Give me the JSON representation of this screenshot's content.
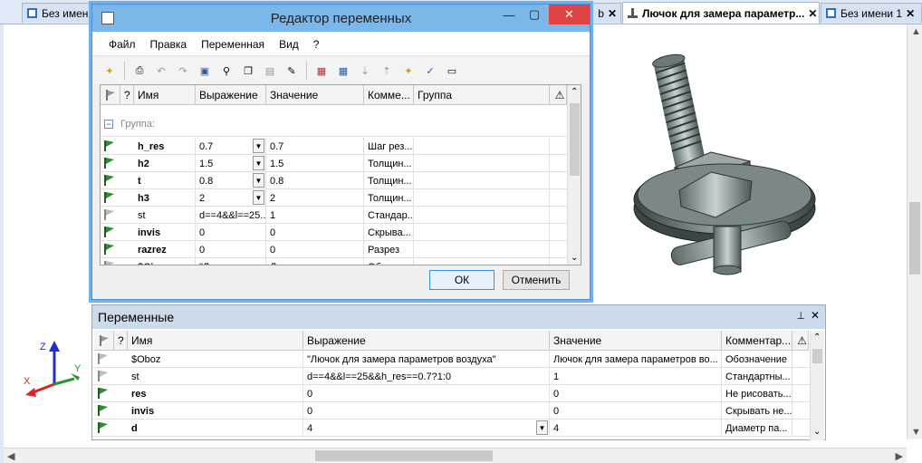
{
  "doc_tabs": [
    {
      "label": "Без имени",
      "close": ""
    },
    {
      "label": "b",
      "close": "✕"
    },
    {
      "label": "Лючок для замера параметр...",
      "close": "✕"
    },
    {
      "label": "Без имени 1",
      "close": "✕"
    }
  ],
  "dialog": {
    "title": "Редактор переменных",
    "menus": [
      "Файл",
      "Правка",
      "Переменная",
      "Вид",
      "?"
    ],
    "columns": [
      "",
      "?",
      "Имя",
      "Выражение",
      "Значение",
      "Комме...",
      "Группа"
    ],
    "group_label": "Группа:",
    "rows": [
      {
        "flag": true,
        "name": "h_res",
        "bold": true,
        "expr": "0.7",
        "dropdown": true,
        "value": "0.7",
        "comment": "Шаг рез..."
      },
      {
        "flag": true,
        "name": "h2",
        "bold": true,
        "expr": "1.5",
        "dropdown": true,
        "value": "1.5",
        "comment": "Толщин..."
      },
      {
        "flag": true,
        "name": "t",
        "bold": true,
        "expr": "0.8",
        "dropdown": true,
        "value": "0.8",
        "comment": "Толщин..."
      },
      {
        "flag": true,
        "name": "h3",
        "bold": true,
        "expr": "2",
        "dropdown": true,
        "value": "2",
        "comment": "Толщин..."
      },
      {
        "flag": false,
        "name": "st",
        "bold": false,
        "expr": "d==4&&l==25...",
        "dropdown": false,
        "value": "1",
        "comment": "Стандар..."
      },
      {
        "flag": true,
        "name": "invis",
        "bold": true,
        "expr": "0",
        "dropdown": false,
        "value": "0",
        "comment": "Скрыва..."
      },
      {
        "flag": true,
        "name": "razrez",
        "bold": true,
        "expr": "0",
        "dropdown": false,
        "value": "0",
        "comment": "Разрез"
      },
      {
        "flag": false,
        "name": "$Oboz",
        "bold": false,
        "expr": "\"Лючок для...",
        "dropdown": false,
        "value": "Лючок для замера...",
        "comment": "Обозна..."
      }
    ],
    "ok_label": "ОК",
    "cancel_label": "Отменить"
  },
  "panel": {
    "title": "Переменные",
    "pin": "ꟷ",
    "close": "✕",
    "columns": [
      "",
      "?",
      "Имя",
      "Выражение",
      "Значение",
      "Комментар..."
    ],
    "rows": [
      {
        "flag": false,
        "name": "$Oboz",
        "bold": false,
        "expr": "\"Лючок для замера параметров воздуха\"",
        "value": "Лючок для замера параметров во...",
        "comment": "Обозначение",
        "dropdown": false
      },
      {
        "flag": false,
        "name": "st",
        "bold": false,
        "expr": "d==4&&l==25&&h_res==0.7?1:0",
        "value": "1",
        "comment": "Стандартны...",
        "dropdown": false
      },
      {
        "flag": true,
        "name": "res",
        "bold": true,
        "expr": "0",
        "value": "0",
        "comment": "Не рисовать...",
        "dropdown": false
      },
      {
        "flag": true,
        "name": "invis",
        "bold": true,
        "expr": "0",
        "value": "0",
        "comment": "Скрывать не...",
        "dropdown": false
      },
      {
        "flag": true,
        "name": "d",
        "bold": true,
        "expr": "4",
        "value": "4",
        "comment": "Диаметр па...",
        "dropdown": true
      }
    ]
  },
  "axes": {
    "x": "X",
    "y": "Y",
    "z": "Z"
  },
  "colors": {
    "flag_green": "#2e8b2e",
    "dialog_border": "#4a90d9",
    "title_bar": "#7cb7ea",
    "panel_title": "#cddaea",
    "close_red": "#e04343"
  }
}
